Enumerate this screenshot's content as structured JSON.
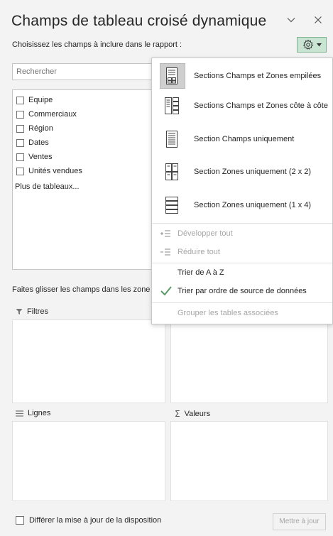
{
  "header": {
    "title": "Champs de tableau croisé dynamique",
    "subtitle": "Choisissez les champs à inclure dans le rapport :"
  },
  "search": {
    "placeholder": "Rechercher"
  },
  "fields": [
    {
      "label": "Equipe",
      "checked": false
    },
    {
      "label": "Commerciaux",
      "checked": false
    },
    {
      "label": "Région",
      "checked": false
    },
    {
      "label": "Dates",
      "checked": false
    },
    {
      "label": "Ventes",
      "checked": false
    },
    {
      "label": "Unités vendues",
      "checked": false
    }
  ],
  "more_tables": "Plus de tableaux...",
  "drag_hint": "Faites glisser les champs dans les zone",
  "zones": {
    "filters": "Filtres",
    "rows": "Lignes",
    "values": "Valeurs"
  },
  "footer": {
    "defer_label": "Différer la mise à jour de la disposition",
    "update_button": "Mettre à jour"
  },
  "menu": {
    "layouts": [
      {
        "label": "Sections Champs et Zones empilées",
        "selected": true,
        "icon": "stacked-layout-icon"
      },
      {
        "label": "Sections Champs et Zones côte à côte",
        "selected": false,
        "icon": "side-by-side-layout-icon"
      },
      {
        "label": "Section Champs uniquement",
        "selected": false,
        "icon": "fields-only-layout-icon"
      },
      {
        "label": "Section Zones uniquement (2 x 2)",
        "selected": false,
        "icon": "areas-2x2-layout-icon"
      },
      {
        "label": "Section Zones uniquement (1 x 4)",
        "selected": false,
        "icon": "areas-1x4-layout-icon"
      }
    ],
    "expand_all": "Développer tout",
    "collapse_all": "Réduire tout",
    "sort_az": "Trier de A à Z",
    "sort_source": "Trier par ordre de source de données",
    "group_tables": "Grouper les tables associées"
  },
  "colors": {
    "accent_green": "#217346",
    "gear_bg": "#c9e4d2",
    "panel_bg": "#f3f3f3"
  }
}
